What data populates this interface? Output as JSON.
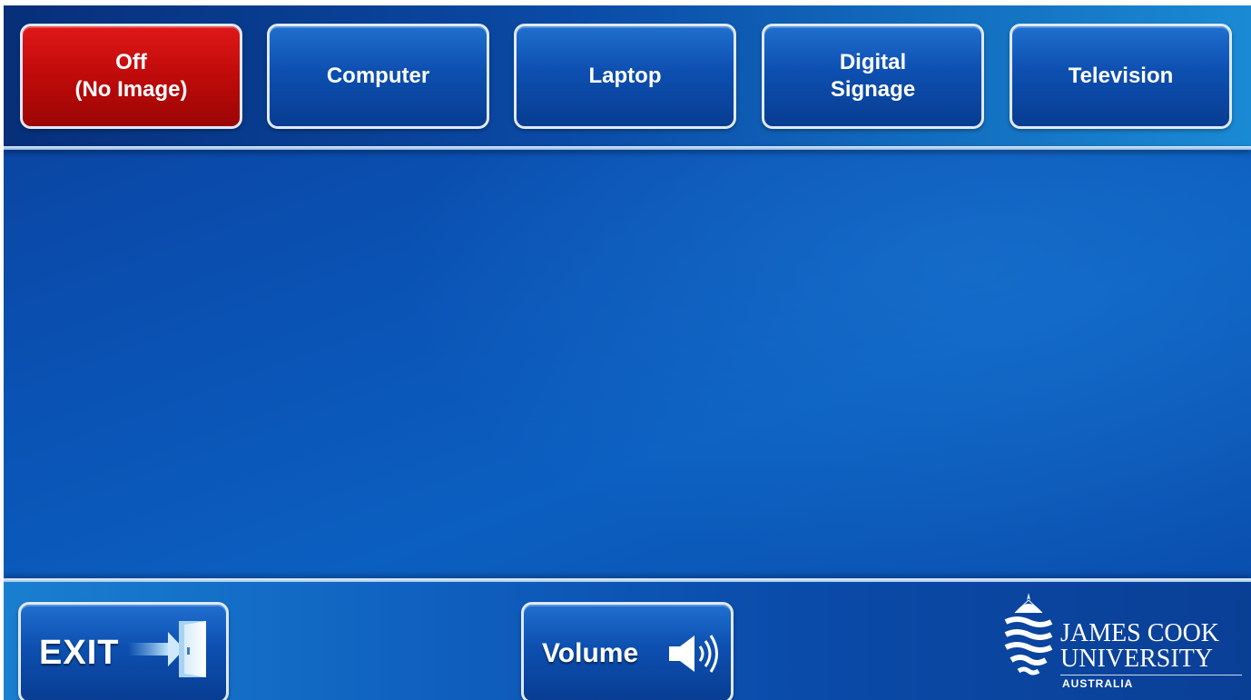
{
  "sources": [
    {
      "label": "Off\n(No Image)",
      "active": true
    },
    {
      "label": "Computer",
      "active": false
    },
    {
      "label": "Laptop",
      "active": false
    },
    {
      "label": "Digital\nSignage",
      "active": false
    },
    {
      "label": "Television",
      "active": false
    }
  ],
  "bottom": {
    "exit_label": "EXIT",
    "exit_icon": "exit-door-icon",
    "volume_label": "Volume",
    "volume_icon": "speaker-icon"
  },
  "logo": {
    "line1": "JAMES COOK",
    "line2": "UNIVERSITY",
    "line3": "AUSTRALIA"
  },
  "colors": {
    "active_source": "#c40c0c",
    "button_blue": "#0d4fb0",
    "button_border": "#dfe9f5",
    "background_blue": "#0a52b4"
  }
}
